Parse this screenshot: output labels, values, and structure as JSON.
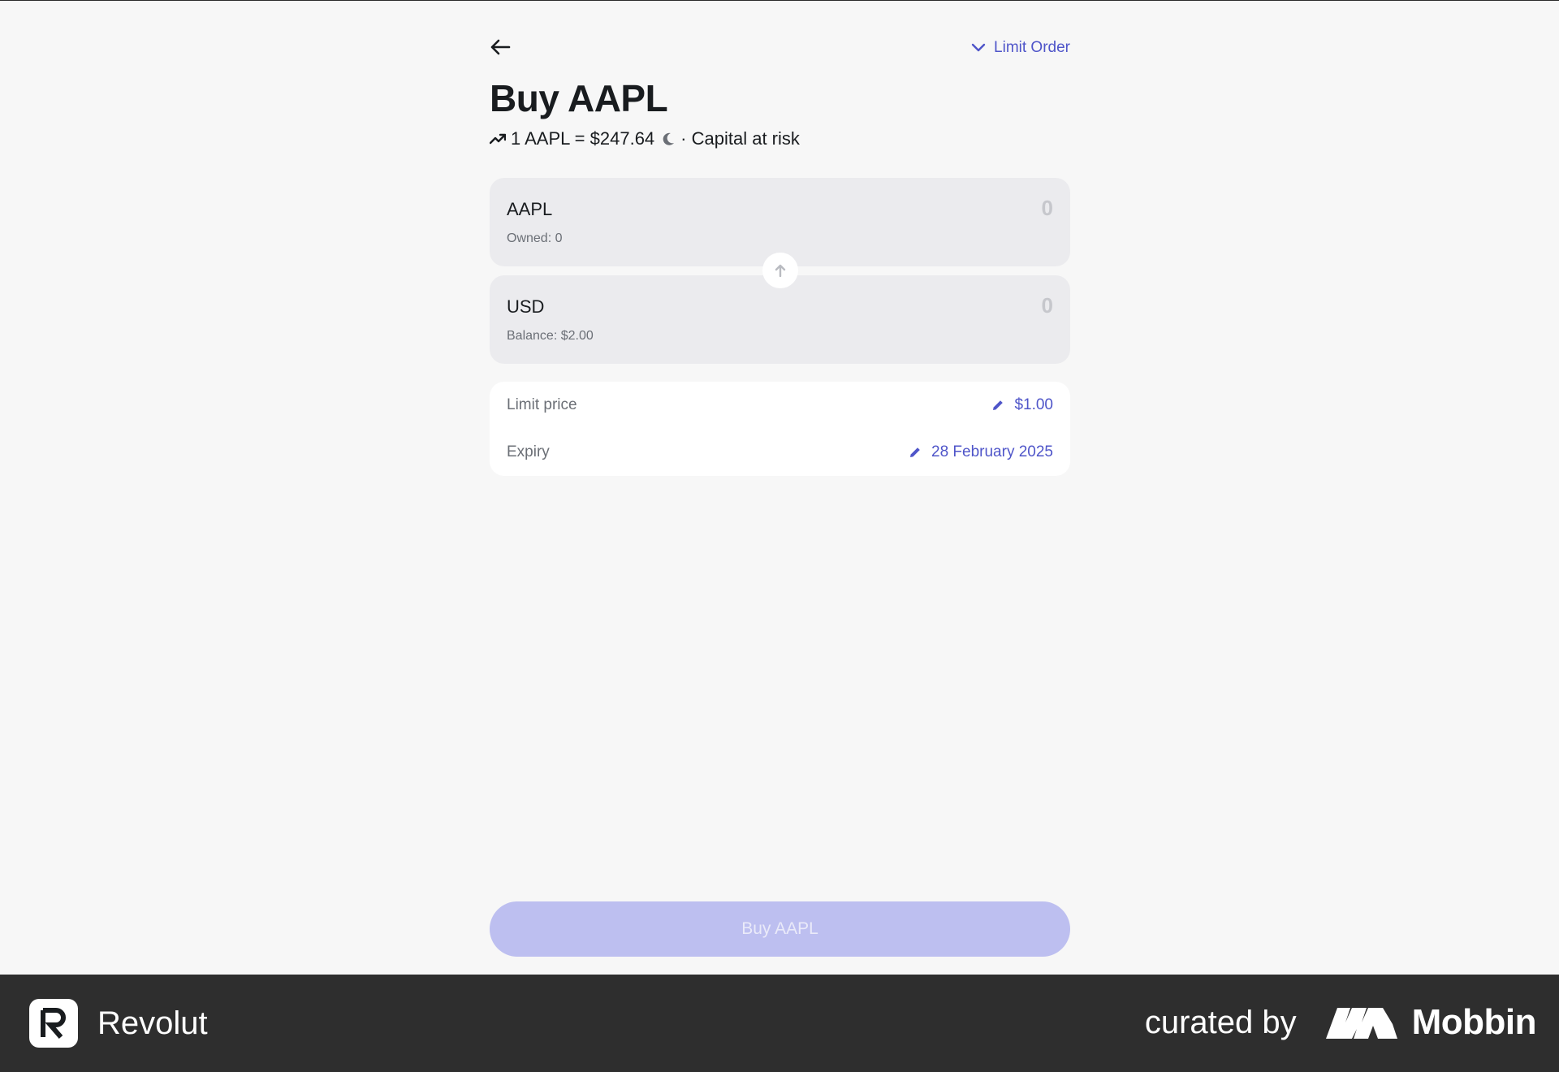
{
  "header": {
    "order_type": "Limit Order",
    "title": "Buy AAPL",
    "rate_text": "1 AAPL = $247.64",
    "risk_text": "· Capital at risk"
  },
  "from_card": {
    "currency": "AAPL",
    "sub": "Owned: 0",
    "amount": "0"
  },
  "to_card": {
    "currency": "USD",
    "sub": "Balance: $2.00",
    "amount": "0"
  },
  "details": {
    "limit_price_label": "Limit price",
    "limit_price_value": "$1.00",
    "expiry_label": "Expiry",
    "expiry_value": "28 February 2025"
  },
  "actions": {
    "buy_label": "Buy AAPL"
  },
  "footer": {
    "brand": "Revolut",
    "curated_by": "curated by",
    "curator": "Mobbin"
  },
  "colors": {
    "accent": "#4f55c9",
    "button_disabled": "#bdbff0",
    "background": "#f7f7f7",
    "card": "#ebebee",
    "footer": "#2e2e2e"
  },
  "icons": [
    "back-arrow-icon",
    "chevron-down-icon",
    "trending-up-icon",
    "moon-icon",
    "swap-arrow-icon",
    "pencil-icon",
    "revolut-logo",
    "mobbin-logo"
  ]
}
